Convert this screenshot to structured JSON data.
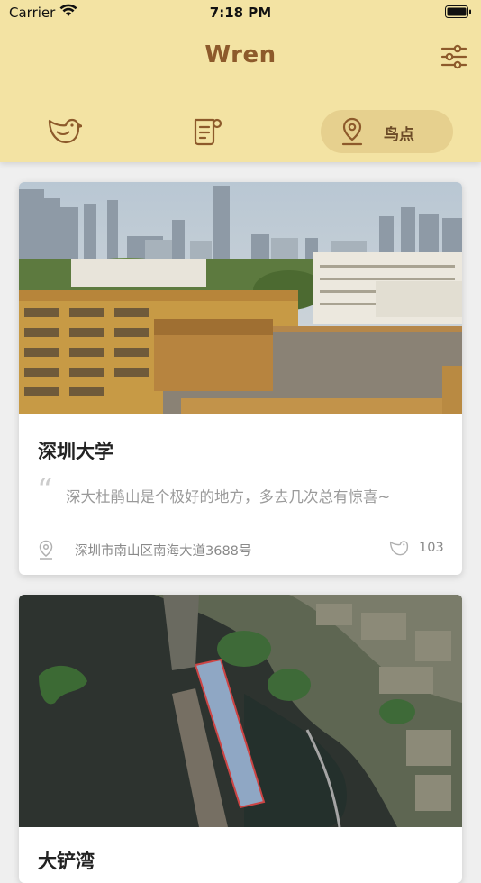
{
  "status_bar": {
    "carrier": "Carrier",
    "time": "7:18 PM"
  },
  "app": {
    "title": "Wren"
  },
  "tabs": [
    {
      "name": "birds",
      "icon": "bird-icon",
      "label": ""
    },
    {
      "name": "notes",
      "icon": "note-icon",
      "label": ""
    },
    {
      "name": "spots",
      "icon": "location-pin-icon",
      "label": "鸟点",
      "selected": true
    }
  ],
  "cards": [
    {
      "title": "深圳大学",
      "quote": "深大杜鹃山是个极好的地方，多去几次总有惊喜~",
      "address": "深圳市南山区南海大道3688号",
      "count": "103",
      "photo": "city-campus-rooftop-photo"
    },
    {
      "title": "大铲湾",
      "photo": "satellite-bay-photo"
    }
  ],
  "colors": {
    "header_bg": "#f3e3a3",
    "accent_brown": "#8d5a2b",
    "selected_tab_bg": "#e6d08e"
  }
}
